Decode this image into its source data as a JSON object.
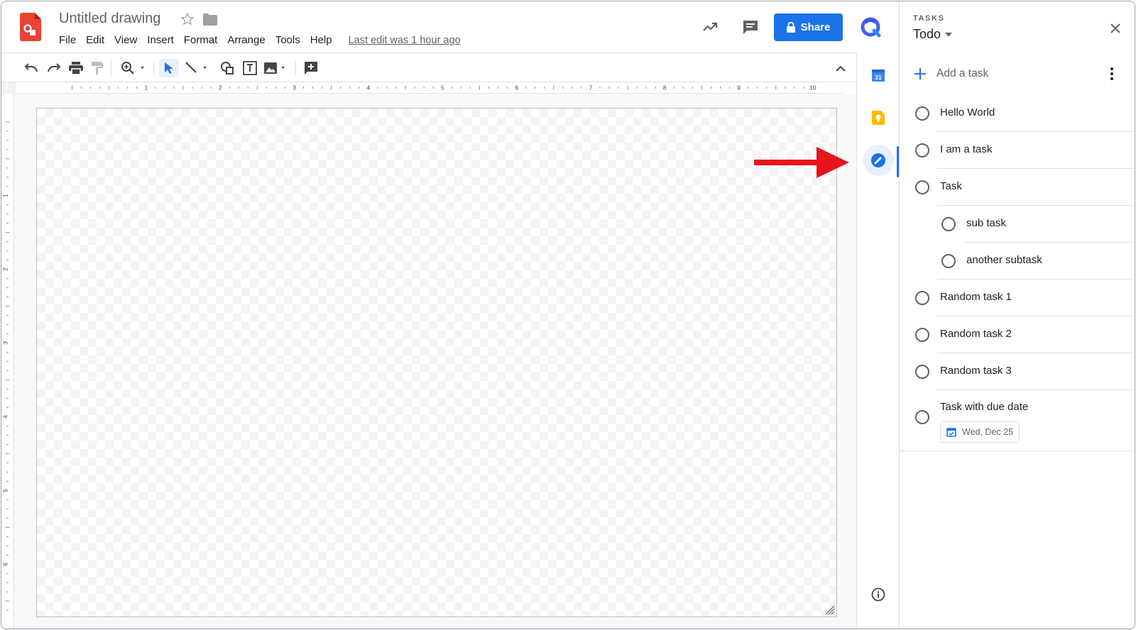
{
  "header": {
    "title": "Untitled drawing",
    "menu": [
      "File",
      "Edit",
      "View",
      "Insert",
      "Format",
      "Arrange",
      "Tools",
      "Help"
    ],
    "last_edit": "Last edit was 1 hour ago",
    "share_label": "Share",
    "icons": [
      "trending-icon",
      "comment-icon",
      "lock-icon",
      "account-icon"
    ]
  },
  "toolbar": {
    "icons": [
      "undo-icon",
      "redo-icon",
      "print-icon",
      "paint-format-icon",
      "zoom-icon",
      "select-icon",
      "line-icon",
      "shape-icon",
      "textbox-icon",
      "image-icon",
      "comment-add-icon",
      "collapse-icon"
    ]
  },
  "ruler": {
    "top_numbers": [
      "1",
      "2",
      "3",
      "4",
      "5",
      "6",
      "7",
      "8",
      "9",
      "10"
    ],
    "left_numbers": [
      "1",
      "2",
      "3",
      "4",
      "5",
      "6"
    ]
  },
  "side_panel": {
    "icons": [
      "calendar-icon",
      "keep-icon",
      "tasks-icon",
      "info-icon"
    ],
    "calendar_day": "31",
    "active": "tasks-icon"
  },
  "tasks": {
    "kicker": "TASKS",
    "list_name": "Todo",
    "add_label": "Add a task",
    "items": [
      {
        "label": "Hello World",
        "indent": 0
      },
      {
        "label": "I am a task",
        "indent": 0
      },
      {
        "label": "Task",
        "indent": 0
      },
      {
        "label": "sub task",
        "indent": 1
      },
      {
        "label": "another subtask",
        "indent": 1
      },
      {
        "label": "Random task 1",
        "indent": 0
      },
      {
        "label": "Random task 2",
        "indent": 0
      },
      {
        "label": "Random task 3",
        "indent": 0
      },
      {
        "label": "Task with due date",
        "indent": 0,
        "due": "Wed, Dec 25"
      }
    ]
  },
  "colors": {
    "accent": "#1a73e8",
    "arrow": "#e8141c",
    "app_red": "#ea4335",
    "keep_yellow": "#fbbc04"
  }
}
